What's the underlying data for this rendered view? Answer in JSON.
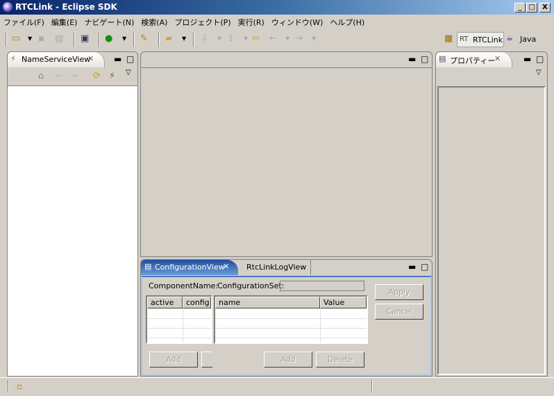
{
  "window": {
    "title": "RTCLink - Eclipse SDK",
    "min": "_",
    "max": "□",
    "close": "X"
  },
  "menu": [
    "ファイル(F)",
    "編集(E)",
    "ナビゲート(N)",
    "検索(A)",
    "プロジェクト(P)",
    "実行(R)",
    "ウィンドウ(W)",
    "ヘルプ(H)"
  ],
  "perspectives": {
    "rtclink": "RTCLink",
    "rt_badge": "RT",
    "java": "Java"
  },
  "left_view": {
    "tab": "NameServiceView"
  },
  "right_view": {
    "tab": "プロパティー"
  },
  "bottom_view": {
    "tabs": [
      "ConfigurationView",
      "RtcLinkLogView"
    ],
    "component_name_label": "ComponentName:",
    "configuration_set_label": "ConfigurationSet:",
    "configuration_set_value": "",
    "left_table": {
      "columns": [
        "active",
        "config"
      ]
    },
    "right_table": {
      "columns": [
        "name",
        "Value"
      ]
    },
    "buttons": {
      "apply": "Apply",
      "cancel": "Cancel",
      "add_left": "Add",
      "add_right": "Add",
      "delete": "Delete"
    }
  }
}
